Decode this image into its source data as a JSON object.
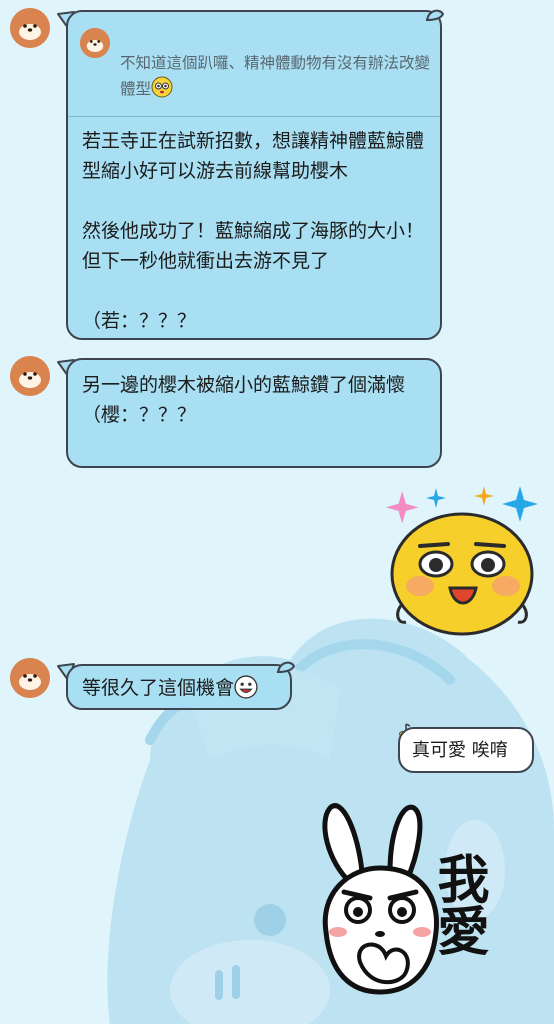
{
  "messages": [
    {
      "sender": "them",
      "reply_quote": "不知道這個趴囉、精神體動物有沒有辦法改變體型",
      "text": "若王寺正在試新招數，想讓精神體藍鯨體型縮小好可以游去前線幫助櫻木\n\n然後他成功了！藍鯨縮成了海豚的大小！但下一秒他就衝出去游不見了\n\n（若：？？？"
    },
    {
      "sender": "them",
      "text": "另一邊的櫻木被縮小的藍鯨鑽了個滿懷\n（櫻：？？？"
    },
    {
      "sender": "them",
      "text": "等很久了這個機會"
    },
    {
      "sender": "me",
      "text": "真可愛 唉唷"
    }
  ],
  "sticker_bunny": {
    "text": "我愛"
  },
  "colors": {
    "background": "#dff4fb",
    "bubble_them": "#a9dff3",
    "bubble_me": "#ffffff",
    "border": "#3e4550",
    "avatar": "#d9844f"
  },
  "icons": [
    "avatar-bear-icon",
    "yellow-emoji-icon",
    "sparkle-icon",
    "sticker-yellow-face",
    "sticker-bunny"
  ]
}
